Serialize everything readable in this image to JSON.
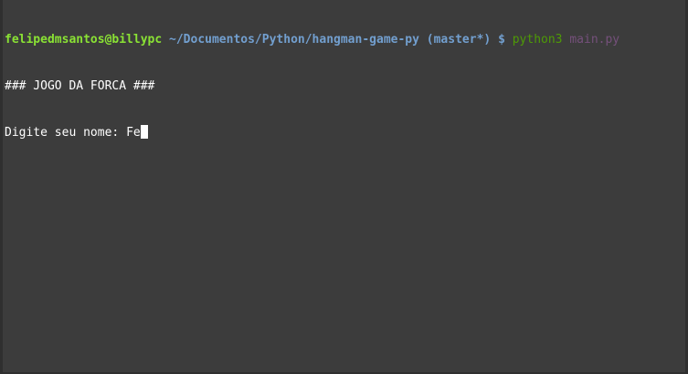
{
  "prompt": {
    "userhost": "felipedmsantos@billypc",
    "path": "~/Documentos/Python/hangman-game-py",
    "branch": "(master*)",
    "symbol": "$",
    "command": "python3",
    "argument": "main.py"
  },
  "output": {
    "title_line": "### JOGO DA FORCA ###",
    "input_prompt": "Digite seu nome: ",
    "input_value": "Fe"
  },
  "colors": {
    "background": "#3c3c3c",
    "userhost": "#8ae234",
    "path": "#729fcf",
    "command": "#4e9a06",
    "argument": "#75507b",
    "text": "#ffffff"
  }
}
